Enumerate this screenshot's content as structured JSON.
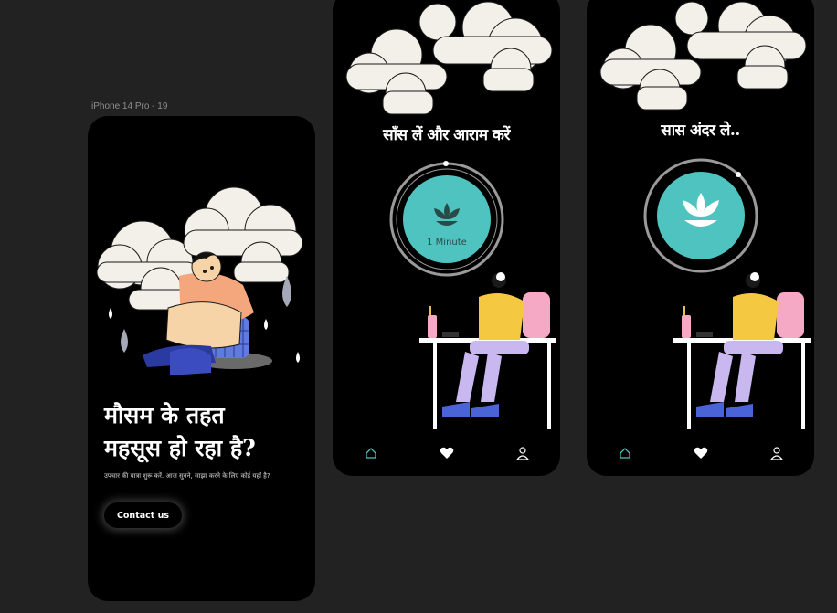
{
  "frames": {
    "label": "iPhone 14 Pro - 19"
  },
  "screen1": {
    "headline_line1": "मौसम के तहत",
    "headline_line2": "महसूस हो रहा है?",
    "subtext": "उपचार की यात्रा शुरू करें. आज सुनने, साझा करने के लिए कोई यहाँ है?",
    "cta_label": "Contact us"
  },
  "screen2": {
    "title": "साँस लें और आराम करें",
    "timer_label": "1 Minute",
    "nav": [
      "home-icon",
      "heart-icon",
      "profile-icon"
    ]
  },
  "screen3": {
    "title": "सास अंदर ले..",
    "nav": [
      "home-icon",
      "heart-icon",
      "profile-icon"
    ]
  },
  "colors": {
    "background": "#222222",
    "phone": "#000000",
    "accent_teal": "#4fc3c0",
    "nav_active": "#4fc3c0",
    "cloud": "#f3efe9"
  }
}
